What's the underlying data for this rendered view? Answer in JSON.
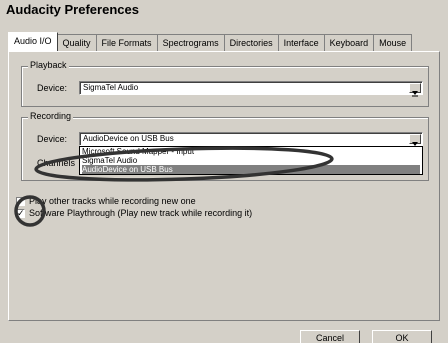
{
  "window": {
    "title": "Audacity Preferences"
  },
  "tabs": [
    "Audio I/O",
    "Quality",
    "File Formats",
    "Spectrograms",
    "Directories",
    "Interface",
    "Keyboard",
    "Mouse"
  ],
  "playback": {
    "group_label": "Playback",
    "device_label": "Device:",
    "device_value": "SigmaTel Audio"
  },
  "recording": {
    "group_label": "Recording",
    "device_label": "Device:",
    "device_value": "AudioDevice on USB Bus",
    "channels_label": "Channels",
    "dropdown_options": [
      "Microsoft Sound Mapper - Input",
      "SigmaTel Audio",
      "AudioDevice on USB Bus"
    ],
    "selected_index": 2
  },
  "options": {
    "play_other_tracks": {
      "label": "Play other tracks while recording new one",
      "checked": false
    },
    "software_playthrough": {
      "label": "Software Playthrough (Play new track while recording it)",
      "checked": true
    }
  },
  "buttons": {
    "cancel": "Cancel",
    "ok": "OK"
  }
}
